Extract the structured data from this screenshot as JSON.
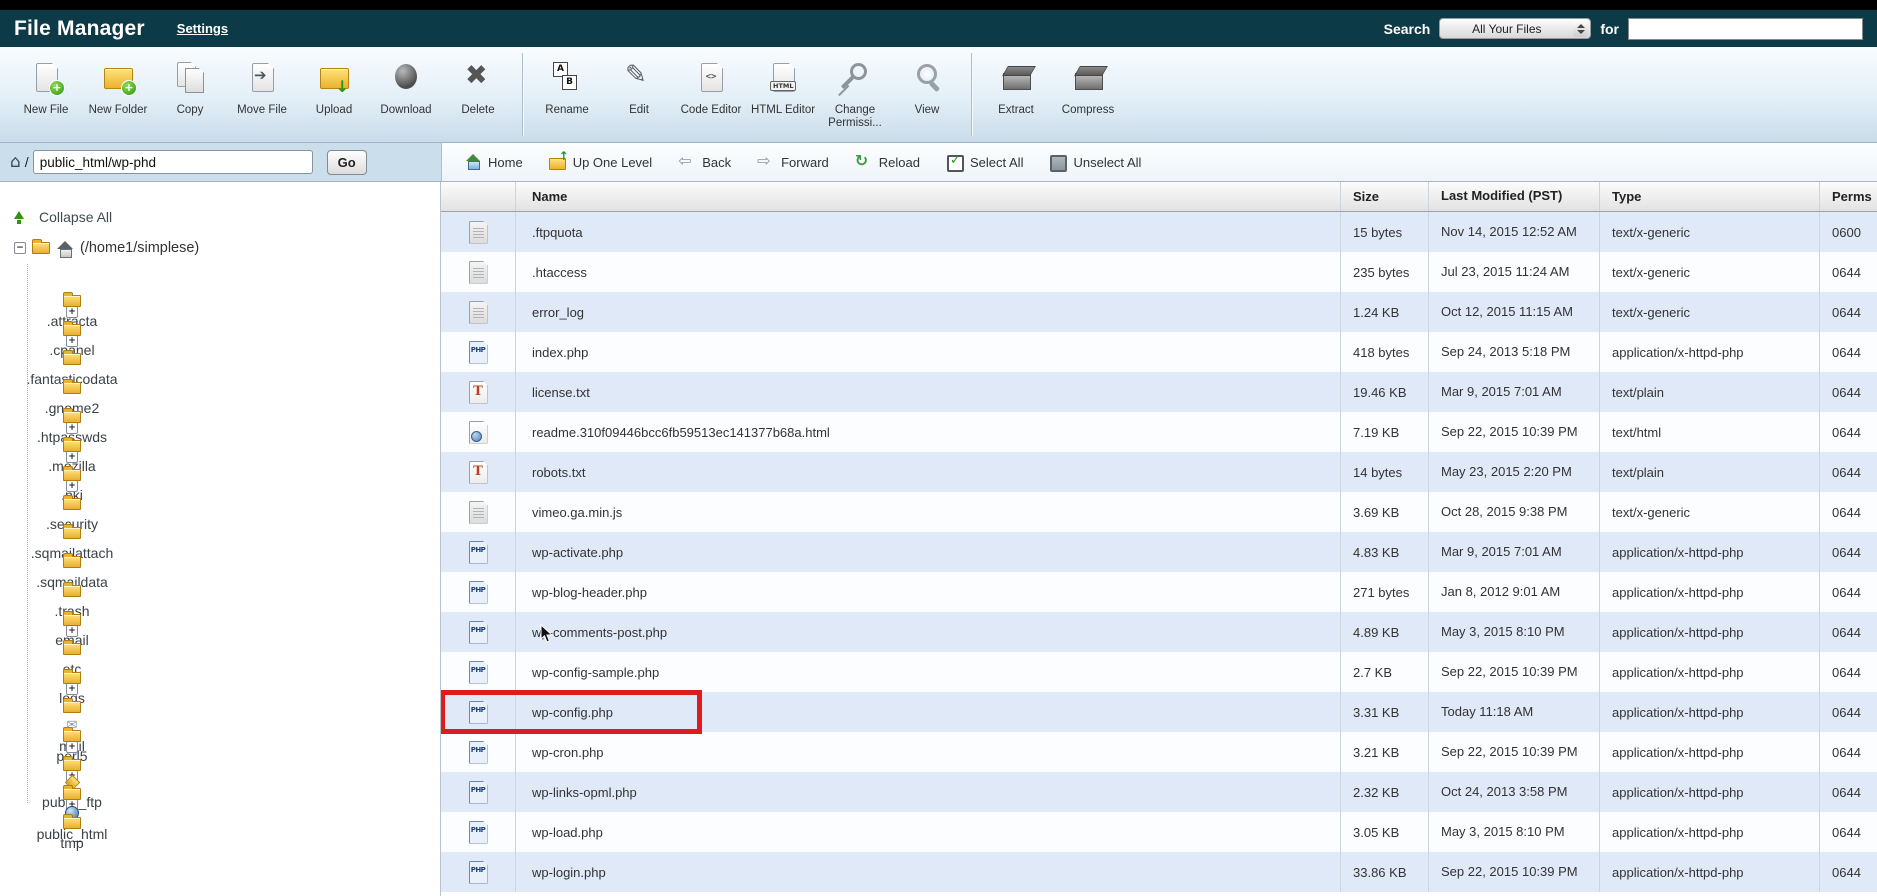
{
  "colors": {
    "header_bg": "#0d3a47",
    "highlight_red": "#dd1d1d",
    "row_alt": "#dfe9f8"
  },
  "header": {
    "title": "File Manager",
    "settings_label": "Settings",
    "search_label": "Search",
    "search_scope": "All Your Files",
    "for_label": "for",
    "search_value": ""
  },
  "toolbar": {
    "groups": [
      {
        "items": [
          {
            "label": "New File",
            "icon": "new-file"
          },
          {
            "label": "New Folder",
            "icon": "new-folder"
          },
          {
            "label": "Copy",
            "icon": "copy"
          },
          {
            "label": "Move File",
            "icon": "move"
          },
          {
            "label": "Upload",
            "icon": "upload"
          },
          {
            "label": "Download",
            "icon": "download"
          },
          {
            "label": "Delete",
            "icon": "delete"
          }
        ]
      },
      {
        "items": [
          {
            "label": "Rename",
            "icon": "rename"
          },
          {
            "label": "Edit",
            "icon": "edit"
          },
          {
            "label": "Code Editor",
            "icon": "code-editor"
          },
          {
            "label": "HTML Editor",
            "icon": "html-editor"
          },
          {
            "label": "Change Permissi...",
            "icon": "change-perms"
          },
          {
            "label": "View",
            "icon": "view"
          }
        ]
      },
      {
        "items": [
          {
            "label": "Extract",
            "icon": "extract"
          },
          {
            "label": "Compress",
            "icon": "compress"
          }
        ]
      }
    ]
  },
  "pathbar": {
    "slash": "/",
    "path_value": "public_html/wp-phd",
    "go_label": "Go"
  },
  "navbar": {
    "items": [
      {
        "label": "Home",
        "icon": "home"
      },
      {
        "label": "Up One Level",
        "icon": "up"
      },
      {
        "label": "Back",
        "icon": "back"
      },
      {
        "label": "Forward",
        "icon": "fwd"
      },
      {
        "label": "Reload",
        "icon": "reload"
      },
      {
        "label": "Select All",
        "icon": "selall"
      },
      {
        "label": "Unselect All",
        "icon": "unsel"
      }
    ]
  },
  "sidebar": {
    "collapse_all_label": "Collapse All",
    "root_label": "(/home1/simplese)",
    "root_expander": "−",
    "items": [
      {
        "label": ".attracta",
        "expander": ""
      },
      {
        "label": ".cpanel",
        "expander": "+"
      },
      {
        "label": ".fantasticodata",
        "expander": "+"
      },
      {
        "label": ".gnome2",
        "expander": ""
      },
      {
        "label": ".htpasswds",
        "expander": ""
      },
      {
        "label": ".mozilla",
        "expander": "+"
      },
      {
        "label": ".pki",
        "expander": "+"
      },
      {
        "label": ".security",
        "expander": "+"
      },
      {
        "label": ".sqmailattach",
        "expander": ""
      },
      {
        "label": ".sqmaildata",
        "expander": ""
      },
      {
        "label": ".trash",
        "expander": ""
      },
      {
        "label": "email",
        "expander": ""
      },
      {
        "label": "etc",
        "expander": "+"
      },
      {
        "label": "logs",
        "expander": ""
      },
      {
        "label": "mail",
        "expander": "+",
        "extra": "mail"
      },
      {
        "label": "perl5",
        "expander": ""
      },
      {
        "label": "public_ftp",
        "expander": "+",
        "extra": "ftp"
      },
      {
        "label": "public_html",
        "expander": "+",
        "extra": "globe"
      },
      {
        "label": "tmp",
        "expander": "+"
      }
    ]
  },
  "table": {
    "columns": [
      "Name",
      "Size",
      "Last Modified (PST)",
      "Type",
      "Perms"
    ],
    "rows": [
      {
        "name": ".ftpquota",
        "icon": "generic",
        "size": "15 bytes",
        "modified": "Nov 14, 2015 12:52 AM",
        "type": "text/x-generic",
        "perms": "0600",
        "highlight": false
      },
      {
        "name": ".htaccess",
        "icon": "generic",
        "size": "235 bytes",
        "modified": "Jul 23, 2015 11:24 AM",
        "type": "text/x-generic",
        "perms": "0644",
        "highlight": false
      },
      {
        "name": "error_log",
        "icon": "generic",
        "size": "1.24 KB",
        "modified": "Oct 12, 2015 11:15 AM",
        "type": "text/x-generic",
        "perms": "0644",
        "highlight": false
      },
      {
        "name": "index.php",
        "icon": "php",
        "size": "418 bytes",
        "modified": "Sep 24, 2013 5:18 PM",
        "type": "application/x-httpd-php",
        "perms": "0644",
        "highlight": false
      },
      {
        "name": "license.txt",
        "icon": "text",
        "size": "19.46 KB",
        "modified": "Mar 9, 2015 7:01 AM",
        "type": "text/plain",
        "perms": "0644",
        "highlight": false
      },
      {
        "name": "readme.310f09446bcc6fb59513ec141377b68a.html",
        "icon": "html",
        "size": "7.19 KB",
        "modified": "Sep 22, 2015 10:39 PM",
        "type": "text/html",
        "perms": "0644",
        "highlight": false
      },
      {
        "name": "robots.txt",
        "icon": "text",
        "size": "14 bytes",
        "modified": "May 23, 2015 2:20 PM",
        "type": "text/plain",
        "perms": "0644",
        "highlight": false
      },
      {
        "name": "vimeo.ga.min.js",
        "icon": "generic",
        "size": "3.69 KB",
        "modified": "Oct 28, 2015 9:38 PM",
        "type": "text/x-generic",
        "perms": "0644",
        "highlight": false
      },
      {
        "name": "wp-activate.php",
        "icon": "php",
        "size": "4.83 KB",
        "modified": "Mar 9, 2015 7:01 AM",
        "type": "application/x-httpd-php",
        "perms": "0644",
        "highlight": false
      },
      {
        "name": "wp-blog-header.php",
        "icon": "php",
        "size": "271 bytes",
        "modified": "Jan 8, 2012 9:01 AM",
        "type": "application/x-httpd-php",
        "perms": "0644",
        "highlight": false
      },
      {
        "name": "wp-comments-post.php",
        "icon": "php",
        "size": "4.89 KB",
        "modified": "May 3, 2015 8:10 PM",
        "type": "application/x-httpd-php",
        "perms": "0644",
        "highlight": false
      },
      {
        "name": "wp-config-sample.php",
        "icon": "php",
        "size": "2.7 KB",
        "modified": "Sep 22, 2015 10:39 PM",
        "type": "application/x-httpd-php",
        "perms": "0644",
        "highlight": false
      },
      {
        "name": "wp-config.php",
        "icon": "php",
        "size": "3.31 KB",
        "modified": "Today 11:18 AM",
        "type": "application/x-httpd-php",
        "perms": "0644",
        "highlight": true
      },
      {
        "name": "wp-cron.php",
        "icon": "php",
        "size": "3.21 KB",
        "modified": "Sep 22, 2015 10:39 PM",
        "type": "application/x-httpd-php",
        "perms": "0644",
        "highlight": false
      },
      {
        "name": "wp-links-opml.php",
        "icon": "php",
        "size": "2.32 KB",
        "modified": "Oct 24, 2013 3:58 PM",
        "type": "application/x-httpd-php",
        "perms": "0644",
        "highlight": false
      },
      {
        "name": "wp-load.php",
        "icon": "php",
        "size": "3.05 KB",
        "modified": "May 3, 2015 8:10 PM",
        "type": "application/x-httpd-php",
        "perms": "0644",
        "highlight": false
      },
      {
        "name": "wp-login.php",
        "icon": "php",
        "size": "33.86 KB",
        "modified": "Sep 22, 2015 10:39 PM",
        "type": "application/x-httpd-php",
        "perms": "0644",
        "highlight": false
      }
    ]
  }
}
